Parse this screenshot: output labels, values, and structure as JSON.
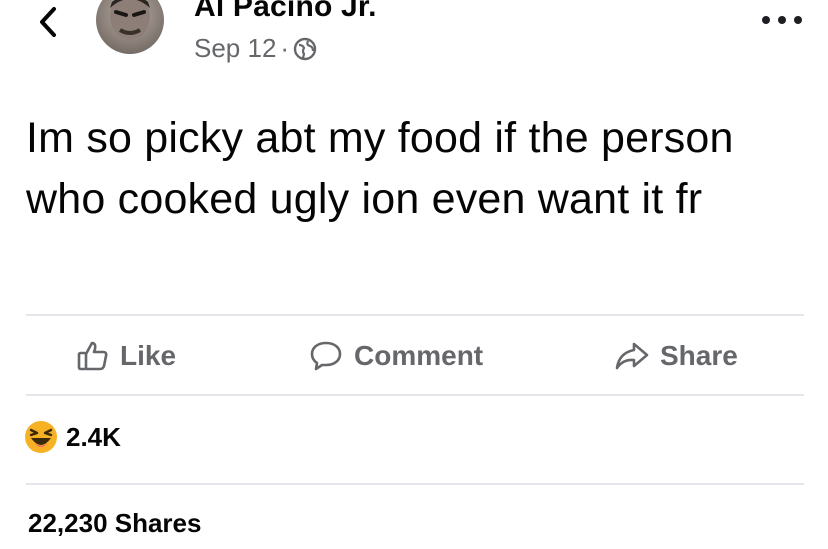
{
  "post": {
    "author": "Al Pacino Jr.",
    "date": "Sep 12",
    "separator": "·",
    "privacy_icon": "globe-icon",
    "text": "Im so picky abt my food if the person who cooked ugly ion even want it fr"
  },
  "actions": {
    "like": "Like",
    "comment": "Comment",
    "share": "Share"
  },
  "stats": {
    "reaction_icon": "haha-reaction-icon",
    "reactions_count": "2.4K",
    "shares": "22,230 Shares"
  },
  "colors": {
    "text_primary": "#050505",
    "text_secondary": "#65676b",
    "divider": "#e4e6eb",
    "haha_yellow": "#f7b125"
  }
}
